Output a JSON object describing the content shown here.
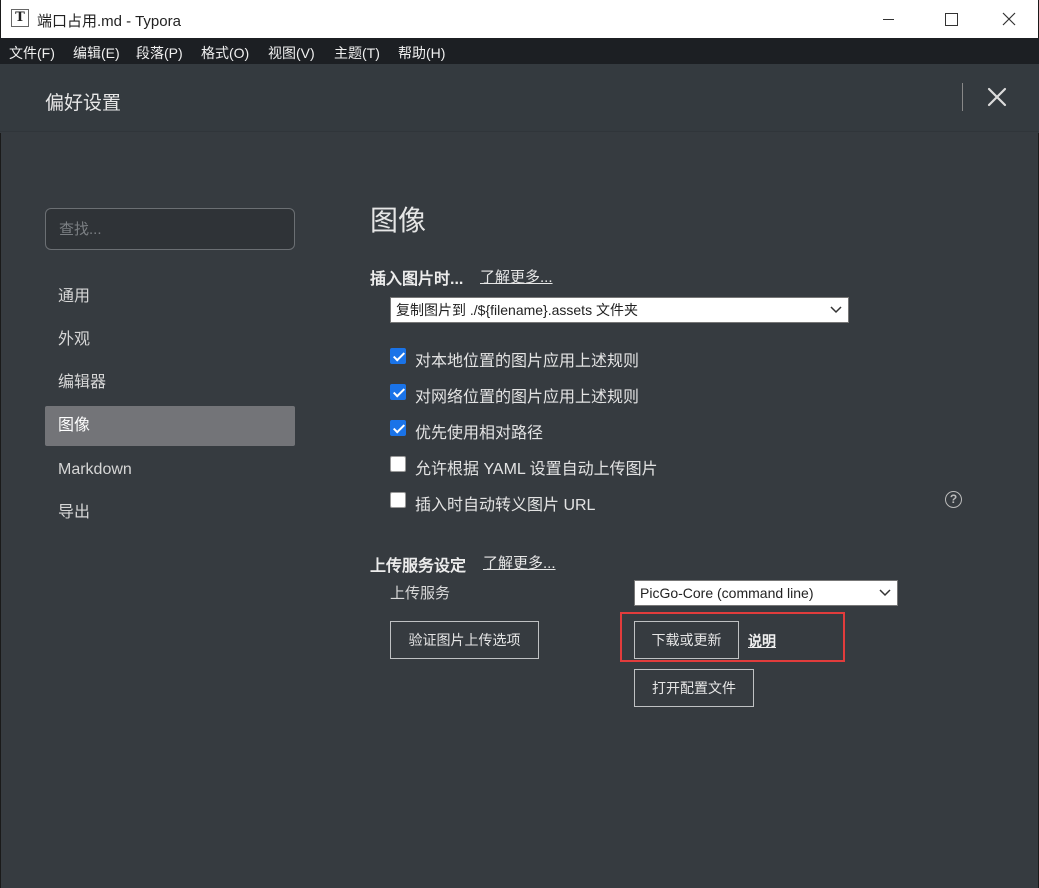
{
  "window": {
    "title": "端口占用.md - Typora",
    "icon_letter": "T"
  },
  "menu": [
    "文件(F)",
    "编辑(E)",
    "段落(P)",
    "格式(O)",
    "视图(V)",
    "主题(T)",
    "帮助(H)"
  ],
  "preferences": {
    "title": "偏好设置",
    "search_placeholder": "查找...",
    "nav": [
      "通用",
      "外观",
      "编辑器",
      "图像",
      "Markdown",
      "导出"
    ],
    "active_nav": "图像"
  },
  "image_section": {
    "title": "图像",
    "insert_label": "插入图片时...",
    "learn_more": "了解更多...",
    "insert_action": "复制图片到 ./${filename}.assets 文件夹",
    "checkboxes": [
      {
        "label": "对本地位置的图片应用上述规则",
        "checked": true
      },
      {
        "label": "对网络位置的图片应用上述规则",
        "checked": true
      },
      {
        "label": "优先使用相对路径",
        "checked": true
      },
      {
        "label": "允许根据 YAML 设置自动上传图片",
        "checked": false
      },
      {
        "label": "插入时自动转义图片 URL",
        "checked": false
      }
    ],
    "help_icon": "?"
  },
  "upload_section": {
    "title": "上传服务设定",
    "learn_more": "了解更多...",
    "service_label": "上传服务",
    "service_value": "PicGo-Core (command line)",
    "verify_button": "验证图片上传选项",
    "download_button": "下载或更新",
    "docs_link": "说明",
    "open_config_button": "打开配置文件"
  },
  "colors": {
    "background": "#363b40",
    "menubar": "#1c1f23",
    "active_nav": "#737478",
    "checkbox_checked": "#1a73e8",
    "highlight": "#e23c3c"
  }
}
